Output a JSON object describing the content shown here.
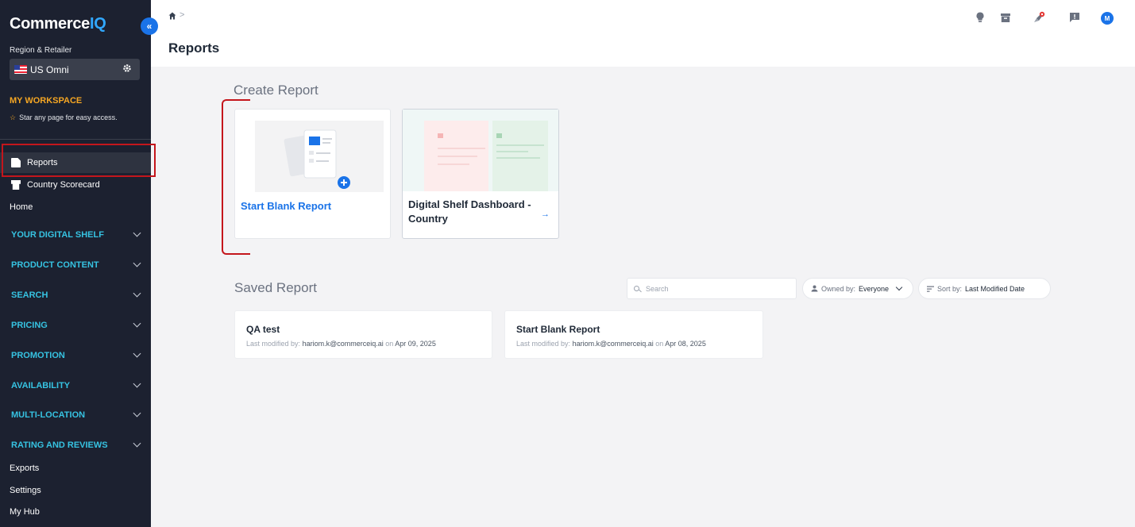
{
  "sidebar": {
    "logo_main": "Commerce",
    "logo_accent": "IQ",
    "collapse_glyph": "«",
    "region_label": "Region & Retailer",
    "region_value": "US Omni",
    "workspace_title": "MY WORKSPACE",
    "workspace_hint": "Star any page for easy access.",
    "items": [
      {
        "label": "Reports",
        "icon": "report-icon"
      },
      {
        "label": "Country Scorecard",
        "icon": "store-icon"
      },
      {
        "label": "Home"
      }
    ],
    "sections": [
      "YOUR DIGITAL SHELF",
      "PRODUCT CONTENT",
      "SEARCH",
      "PRICING",
      "PROMOTION",
      "AVAILABILITY",
      "MULTI-LOCATION",
      "RATING AND REVIEWS"
    ],
    "footer_items": [
      "Exports",
      "Settings",
      "My Hub"
    ]
  },
  "header": {
    "breadcrumb_separator": ">",
    "title": "Reports",
    "avatar_initial": "M",
    "icons": [
      "lightbulb-icon",
      "archive-icon",
      "rocket-icon",
      "feedback-icon"
    ]
  },
  "create": {
    "title": "Create Report",
    "cards": [
      {
        "label": "Start Blank Report"
      },
      {
        "label": "Digital Shelf Dashboard - Country",
        "arrow": "→"
      }
    ]
  },
  "saved": {
    "title": "Saved Report",
    "search_placeholder": "Search",
    "owned_by_label": "Owned by:",
    "owned_by_value": "Everyone",
    "sort_label": "Sort by:",
    "sort_value": "Last Modified Date",
    "modified_prefix": "Last modified by:",
    "on_word": "on",
    "reports": [
      {
        "name": "QA test",
        "user": "hariom.k@commerceiq.ai",
        "date": "Apr 09, 2025"
      },
      {
        "name": "Start Blank Report",
        "user": "hariom.k@commerceiq.ai",
        "date": "Apr 08, 2025"
      }
    ]
  },
  "colors": {
    "sidebar_bg": "#1c2130",
    "section_text": "#36c3e2",
    "workspace_title": "#f5a623",
    "accent_blue": "#1a73e8",
    "highlight_red": "#c4161c"
  }
}
